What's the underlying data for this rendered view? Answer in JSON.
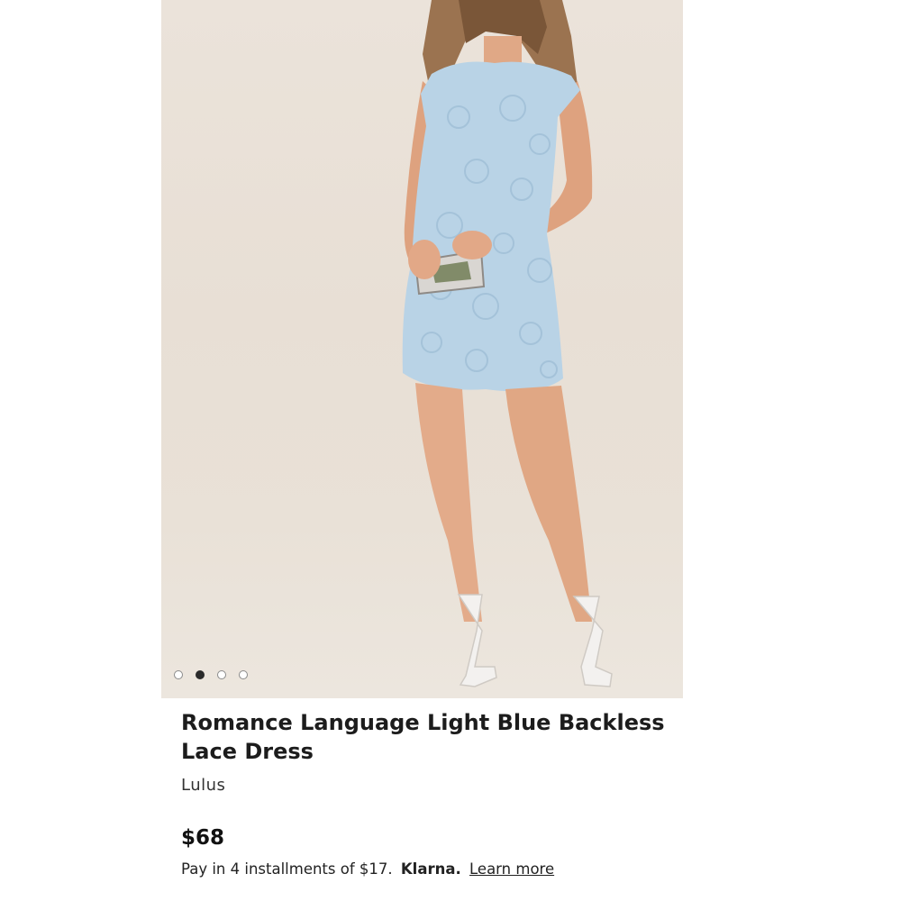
{
  "product": {
    "title": "Romance Language Light Blue Backless Lace Dress",
    "brand": "Lulus",
    "price": "$68",
    "installments_text": "Pay in 4 installments of $17.",
    "klarna_label": "Klarna.",
    "learn_more_label": "Learn more"
  },
  "gallery": {
    "image_count": 4,
    "active_index": 1
  },
  "colors": {
    "dress": "#b9d3e6",
    "background": "#e9e1d7",
    "dot_active": "#2b2b2b"
  }
}
